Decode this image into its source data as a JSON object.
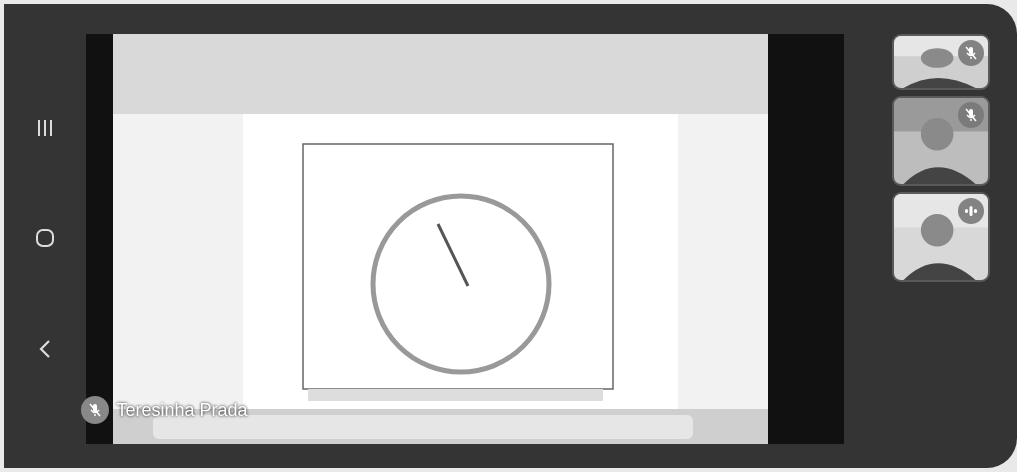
{
  "nav_buttons": [
    {
      "kind": "recents"
    },
    {
      "kind": "home"
    },
    {
      "kind": "back"
    }
  ],
  "presentation": {
    "kind": "picture",
    "presenter": "Teresinha Prada",
    "muted": true
  },
  "participants": [
    {
      "kind": "picture",
      "muted": true,
      "speaking": false
    },
    {
      "kind": "picture",
      "muted": true,
      "speaking": false
    },
    {
      "kind": "picture",
      "muted": false,
      "speaking": true
    }
  ]
}
